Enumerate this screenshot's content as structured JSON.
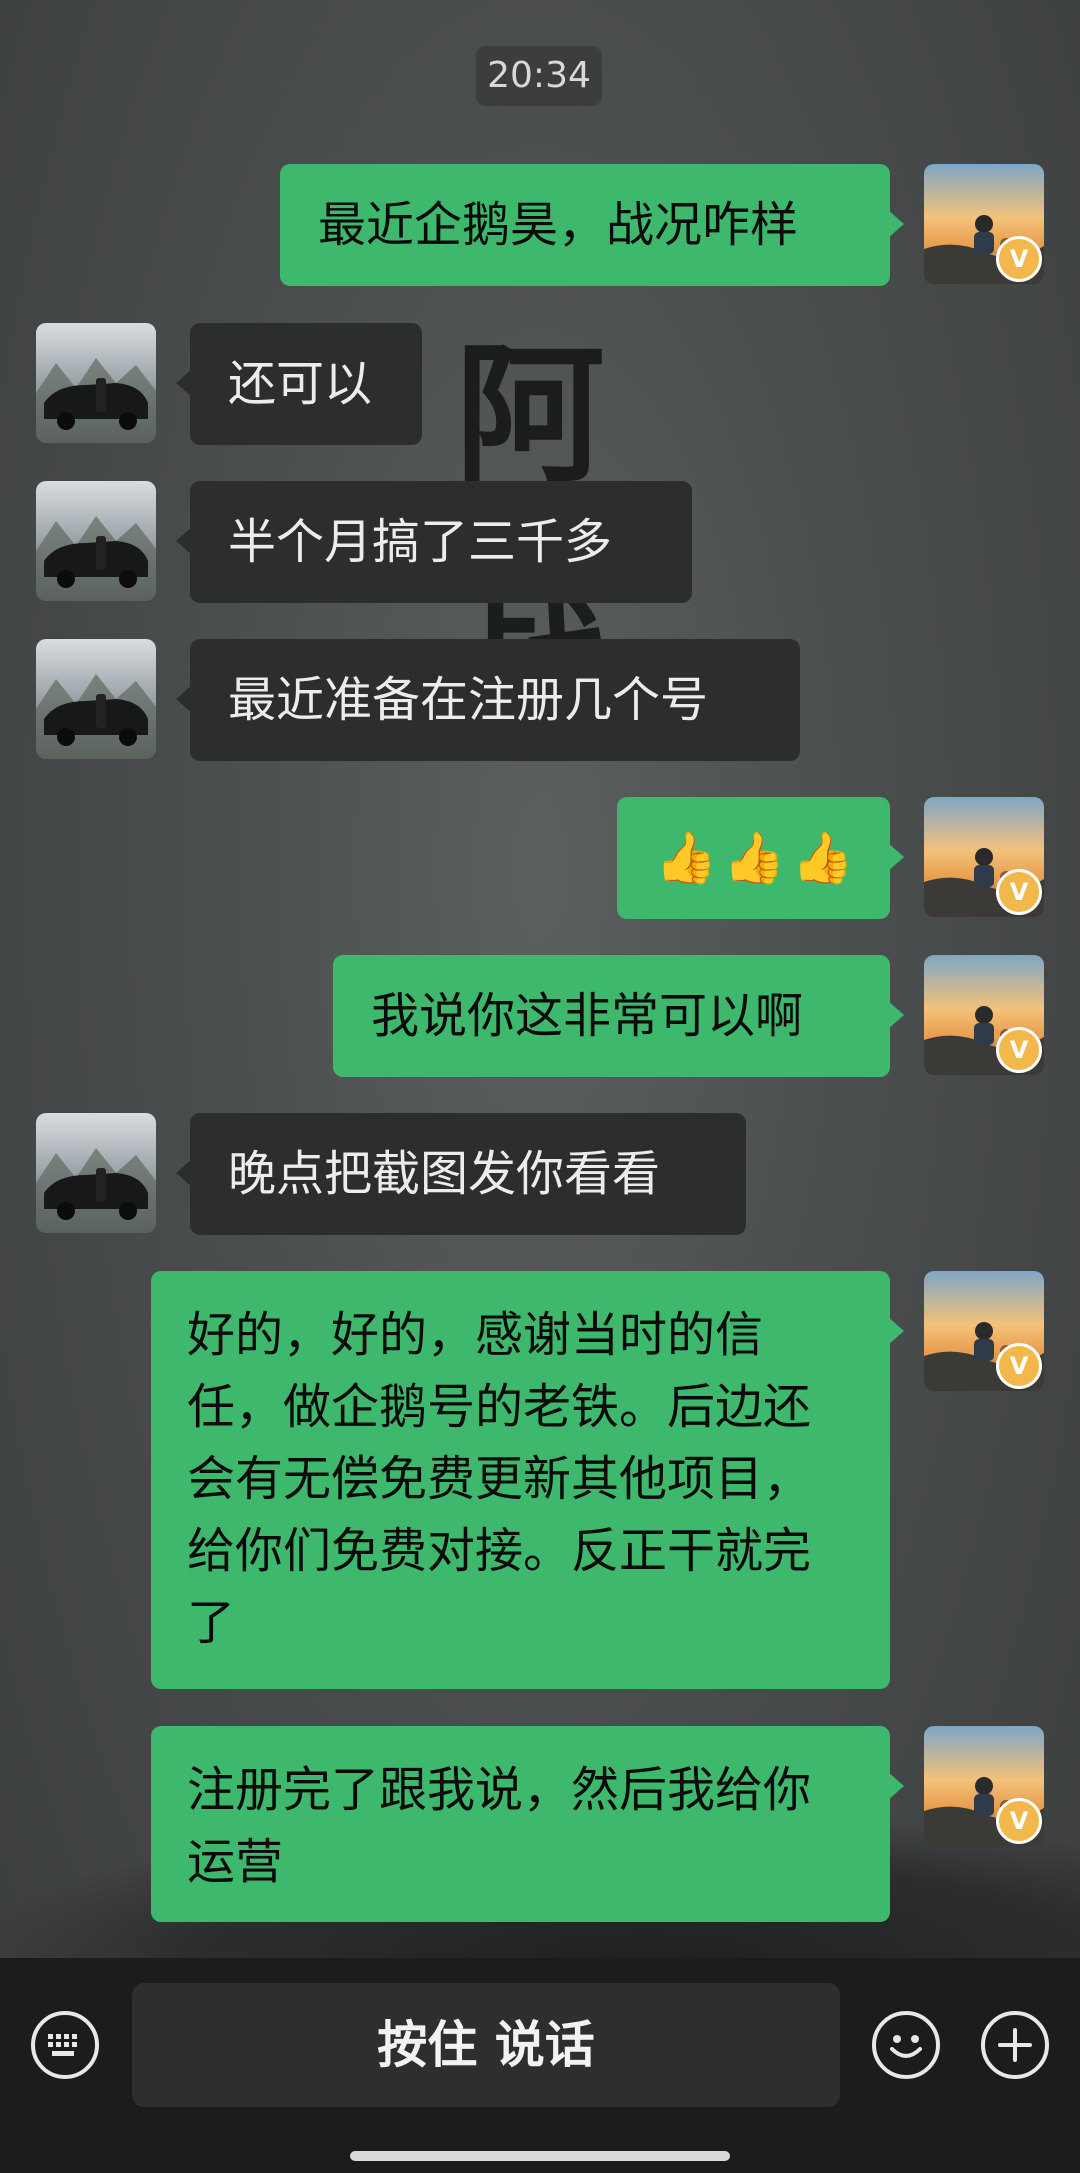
{
  "chat": {
    "timestamp": "20:34",
    "background_text": [
      "阿",
      "",
      "",
      "战",
      "",
      ""
    ],
    "messages": [
      {
        "sender": "me",
        "text": "最近企鹅昊，战况咋样"
      },
      {
        "sender": "other",
        "text": "还可以"
      },
      {
        "sender": "other",
        "text": "半个月搞了三千多"
      },
      {
        "sender": "other",
        "text": "最近准备在注册几个号"
      },
      {
        "sender": "me",
        "text": "👍👍👍"
      },
      {
        "sender": "me",
        "text": "我说你这非常可以啊"
      },
      {
        "sender": "other",
        "text": "晚点把截图发你看看"
      },
      {
        "sender": "me",
        "text": "好的，好的，感谢当时的信任，做企鹅号的老铁。后边还会有无偿免费更新其他项目，给你们免费对接。反正干就完了"
      },
      {
        "sender": "me",
        "text": "注册完了跟我说，然后我给你运营"
      }
    ]
  },
  "avatar_badge": "V",
  "input_bar": {
    "hold_to_talk_label": "按住 说话",
    "icons": [
      "keyboard-icon",
      "emoji-icon",
      "plus-icon"
    ]
  },
  "colors": {
    "my_bubble": "#3db86c",
    "other_bubble": "#2c2d2e",
    "badge": "#f2b84b"
  }
}
